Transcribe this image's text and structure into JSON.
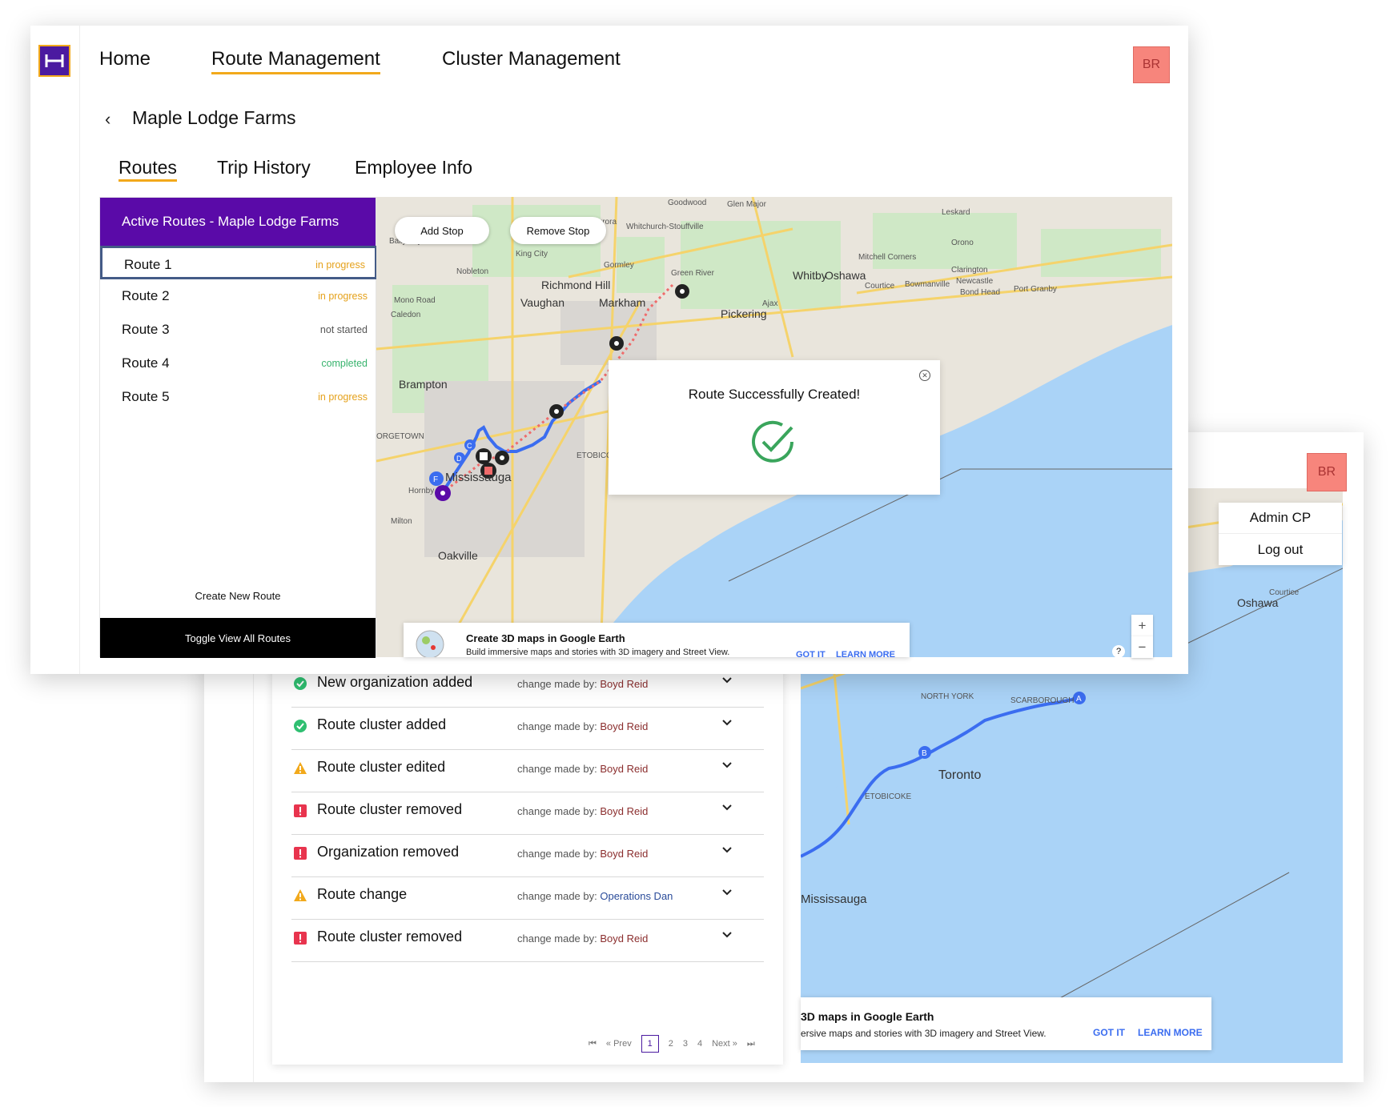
{
  "nav": {
    "home": "Home",
    "route_mgmt": "Route Management",
    "cluster_mgmt": "Cluster Management",
    "avatar": "BR"
  },
  "page": {
    "org_name": "Maple Lodge Farms",
    "tabs": [
      "Routes",
      "Trip History",
      "Employee Info"
    ]
  },
  "sidebar": {
    "header": "Active Routes - Maple Lodge Farms",
    "routes": [
      {
        "name": "Route 1",
        "status": "in progress"
      },
      {
        "name": "Route 2",
        "status": "in progress"
      },
      {
        "name": "Route 3",
        "status": "not started"
      },
      {
        "name": "Route 4",
        "status": "completed"
      },
      {
        "name": "Route 5",
        "status": "in progress"
      }
    ],
    "create_new": "Create New Route",
    "toggle": "Toggle View All Routes"
  },
  "map": {
    "add_stop": "Add Stop",
    "remove_stop": "Remove Stop",
    "success": "Route Successfully Created!",
    "ge_title": "Create 3D maps in Google Earth",
    "ge_sub": "Build immersive maps and stories with 3D imagery and Street View.",
    "ge_got": "GOT IT",
    "ge_learn": "LEARN MORE",
    "labels": {
      "aurora": "Aurora",
      "richmond": "Richmond Hill",
      "vaughan": "Vaughan",
      "markham": "Markham",
      "brampton": "Brampton",
      "mississauga": "Mississauga",
      "oakville": "Oakville",
      "milton": "Milton",
      "pickering": "Pickering",
      "whitby": "Whitby",
      "oshawa": "Oshawa",
      "ajax": "Ajax",
      "kingcity": "King City",
      "nobleton": "Nobleton",
      "caledon": "Caledon",
      "monoroad": "Mono Road",
      "stouffville": "Whitchurch-Stouffville",
      "greenriver": "Green River",
      "glenmajor": "Glen Major",
      "goodwood": "Goodwood",
      "leskard": "Leskard",
      "orono": "Orono",
      "clarington": "Clarington",
      "newcastle": "Newcastle",
      "bondhead": "Bond Head",
      "portgranby": "Port Granby",
      "courtice": "Courtice",
      "bowmanville": "Bowmanville",
      "mitchell": "Mitchell Corners",
      "gormley": "Gormley",
      "hornby": "Hornby",
      "etobicoke": "ETOBICOKE",
      "georgetown": "ORGETOWN",
      "ballycroy": "Ballycroy",
      "toronto": "Toronto",
      "scarborough": "SCARBOROUGH",
      "northyork": "NORTH YORK"
    }
  },
  "map2": {
    "ge_title": "3D maps in Google Earth",
    "ge_sub": "ersive maps and stories with 3D imagery and Street View."
  },
  "account_menu": {
    "avatar": "BR",
    "items": [
      "Admin CP",
      "Log out"
    ]
  },
  "activity_log": {
    "prefix": "change made by:",
    "rows": [
      {
        "title": "New organization added",
        "user": "Boyd Reid",
        "type": "success"
      },
      {
        "title": "Route cluster added",
        "user": "Boyd Reid",
        "type": "success"
      },
      {
        "title": "Route cluster edited",
        "user": "Boyd Reid",
        "type": "warning"
      },
      {
        "title": "Route cluster removed",
        "user": "Boyd Reid",
        "type": "error"
      },
      {
        "title": "Organization removed",
        "user": "Boyd Reid",
        "type": "error"
      },
      {
        "title": "Route change",
        "user": "Operations Dan",
        "type": "warning"
      },
      {
        "title": "Route cluster removed",
        "user": "Boyd Reid",
        "type": "error"
      }
    ],
    "pagination": {
      "prev": "Prev",
      "next": "Next",
      "pages": [
        "1",
        "2",
        "3",
        "4"
      ],
      "current": "1"
    }
  },
  "colors": {
    "brand": "#5a0aa8",
    "accent": "#f2a91b",
    "avatar": "#f7857c",
    "success": "#2fbf71",
    "warning": "#f2a91b",
    "error": "#e8344e",
    "route_line": "#3b6df0",
    "water": "#aad3f7"
  }
}
